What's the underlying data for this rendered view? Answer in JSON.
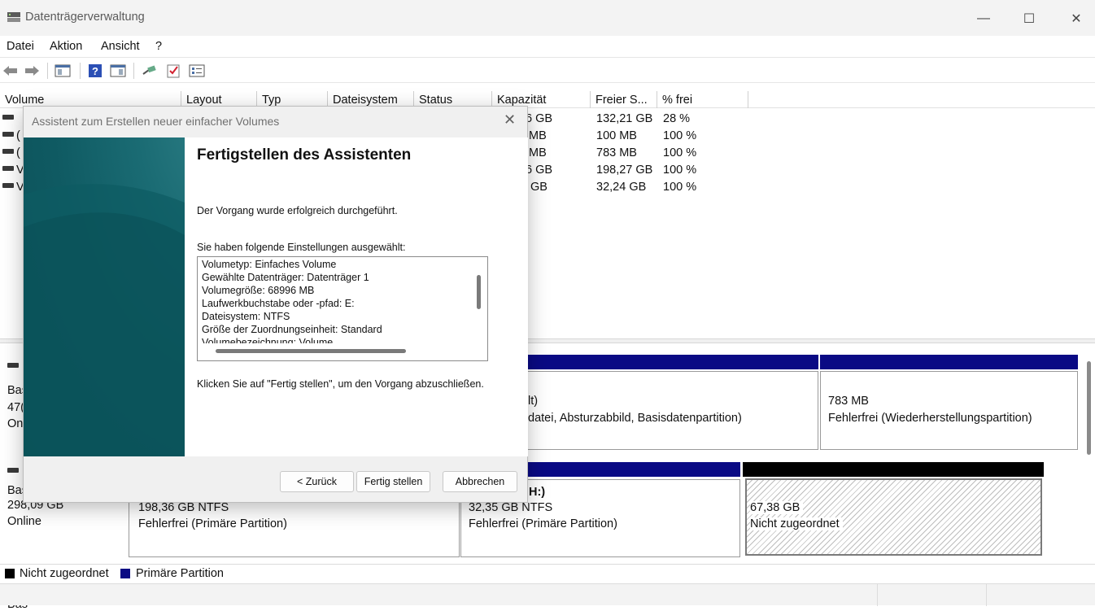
{
  "window": {
    "title": "Datenträgerverwaltung",
    "minimize": "—",
    "maximize": "☐",
    "close": "✕"
  },
  "menu": [
    "Datei",
    "Aktion",
    "Ansicht",
    "?"
  ],
  "columns": [
    "Volume",
    "Layout",
    "Typ",
    "Dateisystem",
    "Status",
    "Kapazität",
    "Freier S...",
    "% frei"
  ],
  "rows": [
    {
      "name": "",
      "capacity": "6 GB",
      "free": "132,21 GB",
      "pct": "28 %"
    },
    {
      "name": "(",
      "capacity": "MB",
      "free": "100 MB",
      "pct": "100 %"
    },
    {
      "name": "(",
      "capacity": "MB",
      "free": "783 MB",
      "pct": "100 %"
    },
    {
      "name": "V",
      "capacity": "6 GB",
      "free": "198,27 GB",
      "pct": "100 %"
    },
    {
      "name": "V",
      "capacity": "GB",
      "free": "32,24 GB",
      "pct": "100 %"
    }
  ],
  "disk0": {
    "label_lines": [
      "Bas",
      "47(",
      "On"
    ],
    "part_partial_line1": "lt)",
    "part_partial_line2": "datei, Absturzabbild, Basisdatenpartition)",
    "recovery_size": "783 MB",
    "recovery_status": "Fehlerfrei (Wiederherstellungspartition)"
  },
  "disk1": {
    "label_lines": [
      "Bas",
      "298,09 GB",
      "Online"
    ],
    "p1_size": "198,36 GB NTFS",
    "p1_status": "Fehlerfrei (Primäre Partition)",
    "p2_name": "H:)",
    "p2_size": "32,35 GB NTFS",
    "p2_status": "Fehlerfrei (Primäre Partition)",
    "unalloc_size": "67,38 GB",
    "unalloc_status": "Nicht zugeordnet"
  },
  "legend": {
    "unallocated": "Nicht zugeordnet",
    "primary": "Primäre Partition"
  },
  "colors": {
    "primary": "#0a0a84",
    "unallocated": "#000000",
    "wizard_side": "#0f5a62"
  },
  "dialog": {
    "title": "Assistent zum Erstellen neuer einfacher Volumes",
    "close": "✕",
    "heading": "Fertigstellen des Assistenten",
    "success": "Der Vorgang wurde erfolgreich durchgeführt.",
    "settings_label": "Sie haben folgende Einstellungen ausgewählt:",
    "settings": [
      "Volumetyp: Einfaches Volume",
      "Gewählte Datenträger: Datenträger 1",
      "Volumegröße: 68996 MB",
      "Laufwerkbuchstabe oder -pfad: E:",
      "Dateisystem: NTFS",
      "Größe der Zuordnungseinheit: Standard",
      "Volumebezeichnung: Volume"
    ],
    "finish_hint": "Klicken Sie auf \"Fertig stellen\", um den Vorgang abzuschließen.",
    "back": "< Zurück",
    "finish": "Fertig stellen",
    "cancel": "Abbrechen"
  }
}
